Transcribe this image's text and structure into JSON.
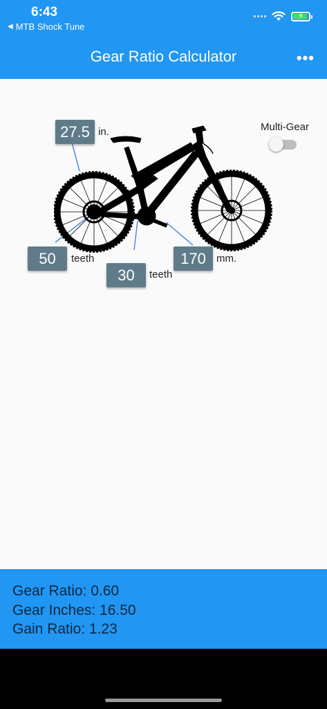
{
  "status": {
    "time": "6:43",
    "back_app": "MTB Shock Tune"
  },
  "app_bar": {
    "title": "Gear Ratio Calculator",
    "more_icon": "more-horiz-icon"
  },
  "inputs": {
    "wheel_size": {
      "value": "27.5",
      "unit": "in."
    },
    "rear_cog": {
      "value": "50",
      "unit": "teeth"
    },
    "chainring": {
      "value": "30",
      "unit": "teeth"
    },
    "crank_length": {
      "value": "170",
      "unit": "mm."
    }
  },
  "multi_gear": {
    "label": "Multi-Gear",
    "enabled": false
  },
  "results": {
    "gear_ratio": "Gear Ratio: 0.60",
    "gear_inches": "Gear Inches: 16.50",
    "gain_ratio": "Gain Ratio: 1.23"
  },
  "colors": {
    "primary": "#2196F3",
    "input_box": "#5f7b89",
    "background": "#fafafa",
    "pointer_line": "#4a90e2"
  }
}
